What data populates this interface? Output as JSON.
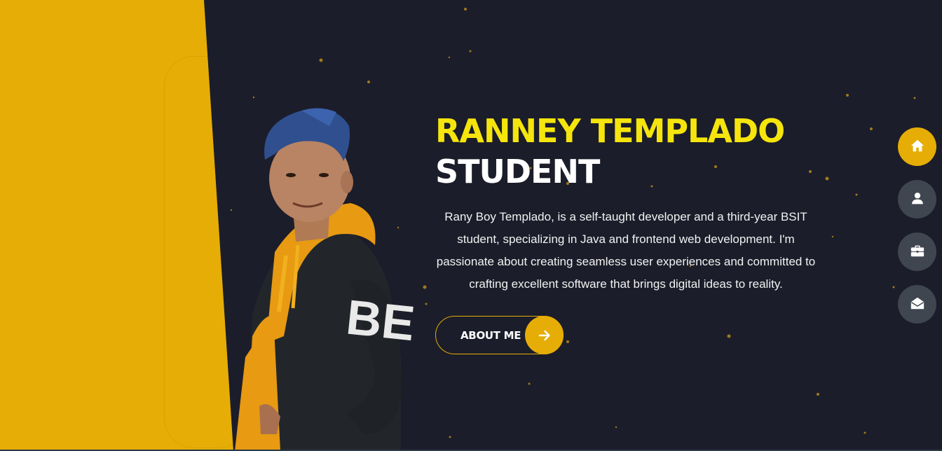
{
  "hero": {
    "name": "RANNEY TEMPLADO",
    "role": "STUDENT",
    "bio": "Rany Boy Templado, is a self-taught developer and a third-year BSIT student, specializing in Java and frontend web development. I'm passionate about creating seamless user experiences and committed to crafting excellent software that brings digital ideas to reality.",
    "cta_label": "ABOUT ME",
    "cta_icon": "arrow-right-icon",
    "portrait_text": "BE"
  },
  "side_nav": {
    "items": [
      {
        "icon": "home-icon",
        "active": true
      },
      {
        "icon": "user-icon",
        "active": false
      },
      {
        "icon": "briefcase-icon",
        "active": false
      },
      {
        "icon": "envelope-open-icon",
        "active": false
      }
    ]
  },
  "colors": {
    "background": "#1b1d2a",
    "accent": "#e5ad06",
    "name": "#f5e50d",
    "nav_inactive": "#3f4650",
    "text": "#ffffff"
  }
}
